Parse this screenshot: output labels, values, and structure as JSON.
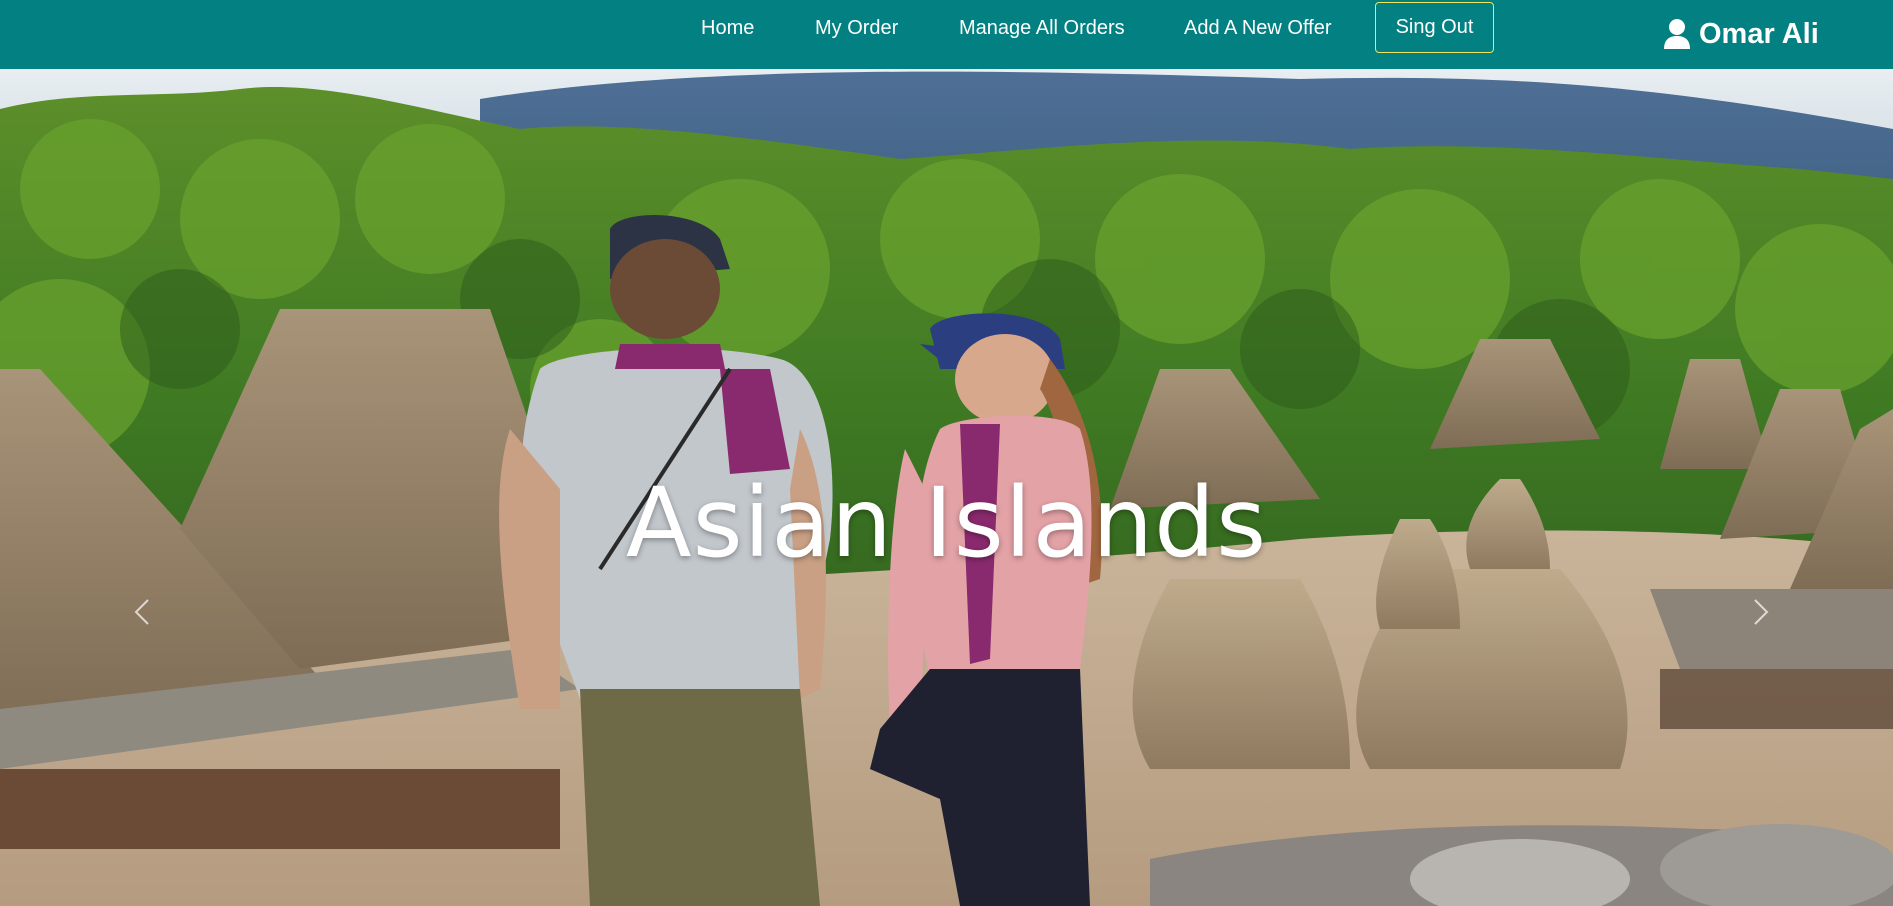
{
  "nav": {
    "links": [
      {
        "label": "Home"
      },
      {
        "label": "My Order"
      },
      {
        "label": "Manage All Orders"
      },
      {
        "label": "Add A New Offer"
      }
    ],
    "signout_label": "Sing Out",
    "user_name": "Omar Ali",
    "user_icon": "user-icon"
  },
  "hero": {
    "title": "Asian Islands",
    "prev_icon": "chevron-left-icon",
    "next_icon": "chevron-right-icon"
  },
  "colors": {
    "navbar": "#038081",
    "signout_border": "#f0e45a",
    "text": "#ffffff"
  }
}
